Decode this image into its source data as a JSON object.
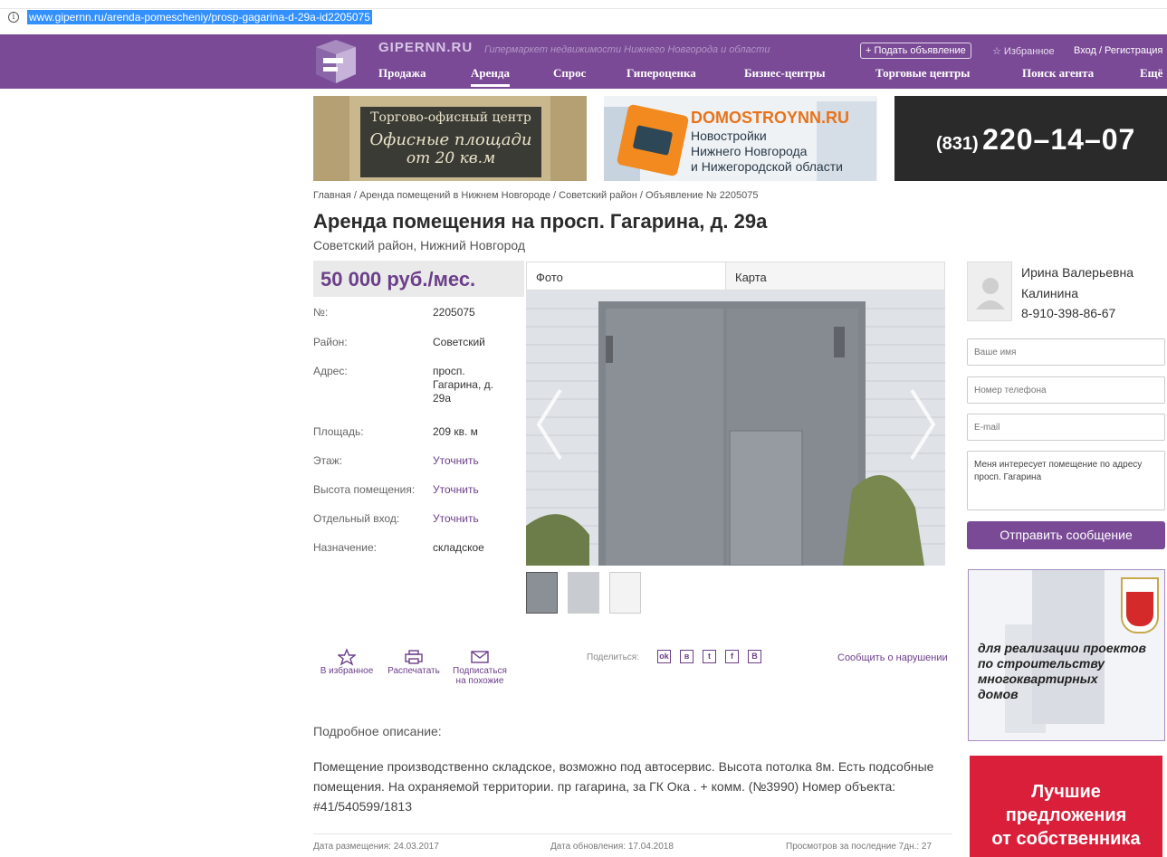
{
  "browser": {
    "url": "www.gipernn.ru/arenda-pomescheniy/prosp-gagarina-d-29a-id2205075"
  },
  "header": {
    "brand": "GIPERNN.RU",
    "tagline": "Гипермаркет недвижимости Нижнего Новгорода и области",
    "post_button": "+ Подать объявление",
    "favorites": "☆ Избранное",
    "login": "Вход / Регистрация",
    "nav": [
      "Продажа",
      "Аренда",
      "Спрос",
      "Гипероценка",
      "Бизнес-центры",
      "Торговые центры",
      "Поиск агента",
      "Ещё"
    ],
    "active_nav": "Аренда",
    "accent_color": "#7a4a96"
  },
  "banners": {
    "office": {
      "line1": "Торгово-офисный центр",
      "line2": "Офисные площади",
      "line3": "от 20 кв.м"
    },
    "domostroy": {
      "title": "DOMOSTROYNN.RU",
      "line1": "Новостройки",
      "line2": "Нижнего Новгорода",
      "line3": "и Нижегородской области"
    },
    "phone": {
      "code": "(831)",
      "number": "220–14–07"
    }
  },
  "breadcrumb": "Главная / Аренда помещений в Нижнем Новгороде / Советский район / Объявление № 2205075",
  "title": "Аренда помещения на просп. Гагарина, д. 29а",
  "subtitle": "Советский район, Нижний Новгород",
  "listing": {
    "price": "50 000 руб./мес.",
    "rows": [
      {
        "label": "№:",
        "value": "2205075"
      },
      {
        "label": "Район:",
        "value": "Советский"
      },
      {
        "label": "Адрес:",
        "value": "просп. Гагарина, д. 29а"
      },
      {
        "label": "Площадь:",
        "value": "209 кв. м"
      },
      {
        "label": "Этаж:",
        "value": "Уточнить"
      },
      {
        "label": "Высота помещения:",
        "value": "Уточнить"
      },
      {
        "label": "Отдельный вход:",
        "value": "Уточнить"
      },
      {
        "label": "Назначение:",
        "value": "складское"
      }
    ]
  },
  "gallery": {
    "tabs": [
      "Фото",
      "Карта"
    ],
    "active_tab": "Фото"
  },
  "actions": {
    "favorite": "В избранное",
    "print": "Распечатать",
    "subscribe_1": "Подписаться",
    "subscribe_2": "на похожие",
    "share_label": "Поделиться:",
    "share_icons": [
      "ok-icon",
      "vk-icon",
      "twitter-icon",
      "facebook-icon",
      "b-icon"
    ],
    "report": "Сообщить о нарушении"
  },
  "description": {
    "heading": "Подробное описание:",
    "text": "Помещение производственно складское, возможно под автосервис. Высота потолка 8м. Есть подсобные помещения. На охраняемой территории. пр гагарина, за ГК Ока . + комм. (№3990) Номер объекта: #41/540599/1813"
  },
  "meta": {
    "posted": "Дата размещения: 24.03.2017",
    "updated": "Дата обновления: 17.04.2018",
    "views": "Просмотров за последние 7дн.: 27"
  },
  "contact": {
    "name_line1": "Ирина Валерьевна",
    "name_line2": "Калинина",
    "phone": "8-910-398-86-67",
    "name_placeholder": "Ваше имя",
    "phone_placeholder": "Номер телефона",
    "email_placeholder": "E-mail",
    "message": "Меня интересует помещение по адресу просп. Гагарина",
    "send": "Отправить сообщение"
  },
  "ads": {
    "ad1": [
      "для реализации проектов",
      "по строительству",
      "многоквартирных",
      "домов"
    ],
    "ad2": [
      "Лучшие",
      "предложения",
      "от собственника"
    ]
  }
}
